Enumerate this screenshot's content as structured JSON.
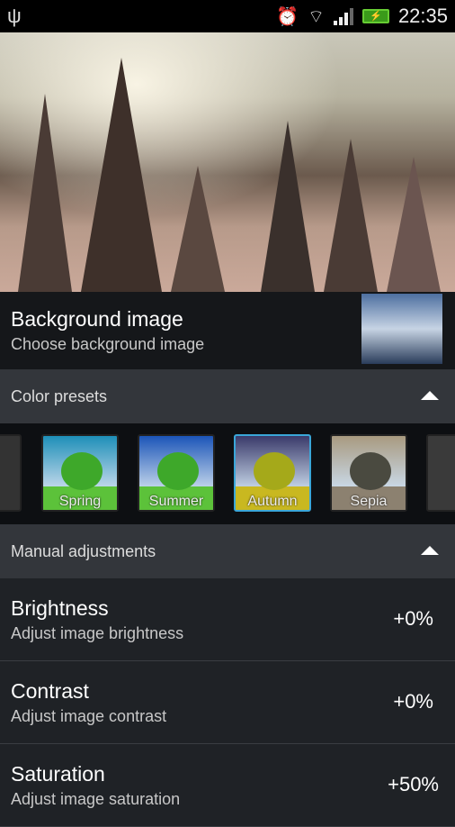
{
  "status_bar": {
    "time": "22:35",
    "icons": [
      "usb-icon",
      "alarm-icon",
      "wifi-icon",
      "signal-icon",
      "battery-charging-icon"
    ]
  },
  "background": {
    "title": "Background image",
    "subtitle": "Choose background image"
  },
  "color_presets": {
    "title": "Color presets",
    "items": [
      {
        "label": "Spring",
        "sky": "#1e8fb8",
        "ground": "#5cc23a",
        "tree": "#3ea82a"
      },
      {
        "label": "Summer",
        "sky": "#1c55b8",
        "ground": "#5cc23a",
        "tree": "#3ea82a"
      },
      {
        "label": "Autumn",
        "sky": "#3a3a6a",
        "ground": "#c9b820",
        "tree": "#a5a91a",
        "selected": true
      },
      {
        "label": "Sepia",
        "sky": "#a89a80",
        "ground": "#8c8170",
        "tree": "#4a4a40"
      }
    ]
  },
  "manual": {
    "title": "Manual adjustments",
    "items": [
      {
        "title": "Brightness",
        "subtitle": "Adjust image brightness",
        "value": "+0%"
      },
      {
        "title": "Contrast",
        "subtitle": "Adjust image contrast",
        "value": "+0%"
      },
      {
        "title": "Saturation",
        "subtitle": "Adjust image saturation",
        "value": "+50%"
      }
    ]
  },
  "colors": {
    "selection": "#3aa6d8"
  }
}
